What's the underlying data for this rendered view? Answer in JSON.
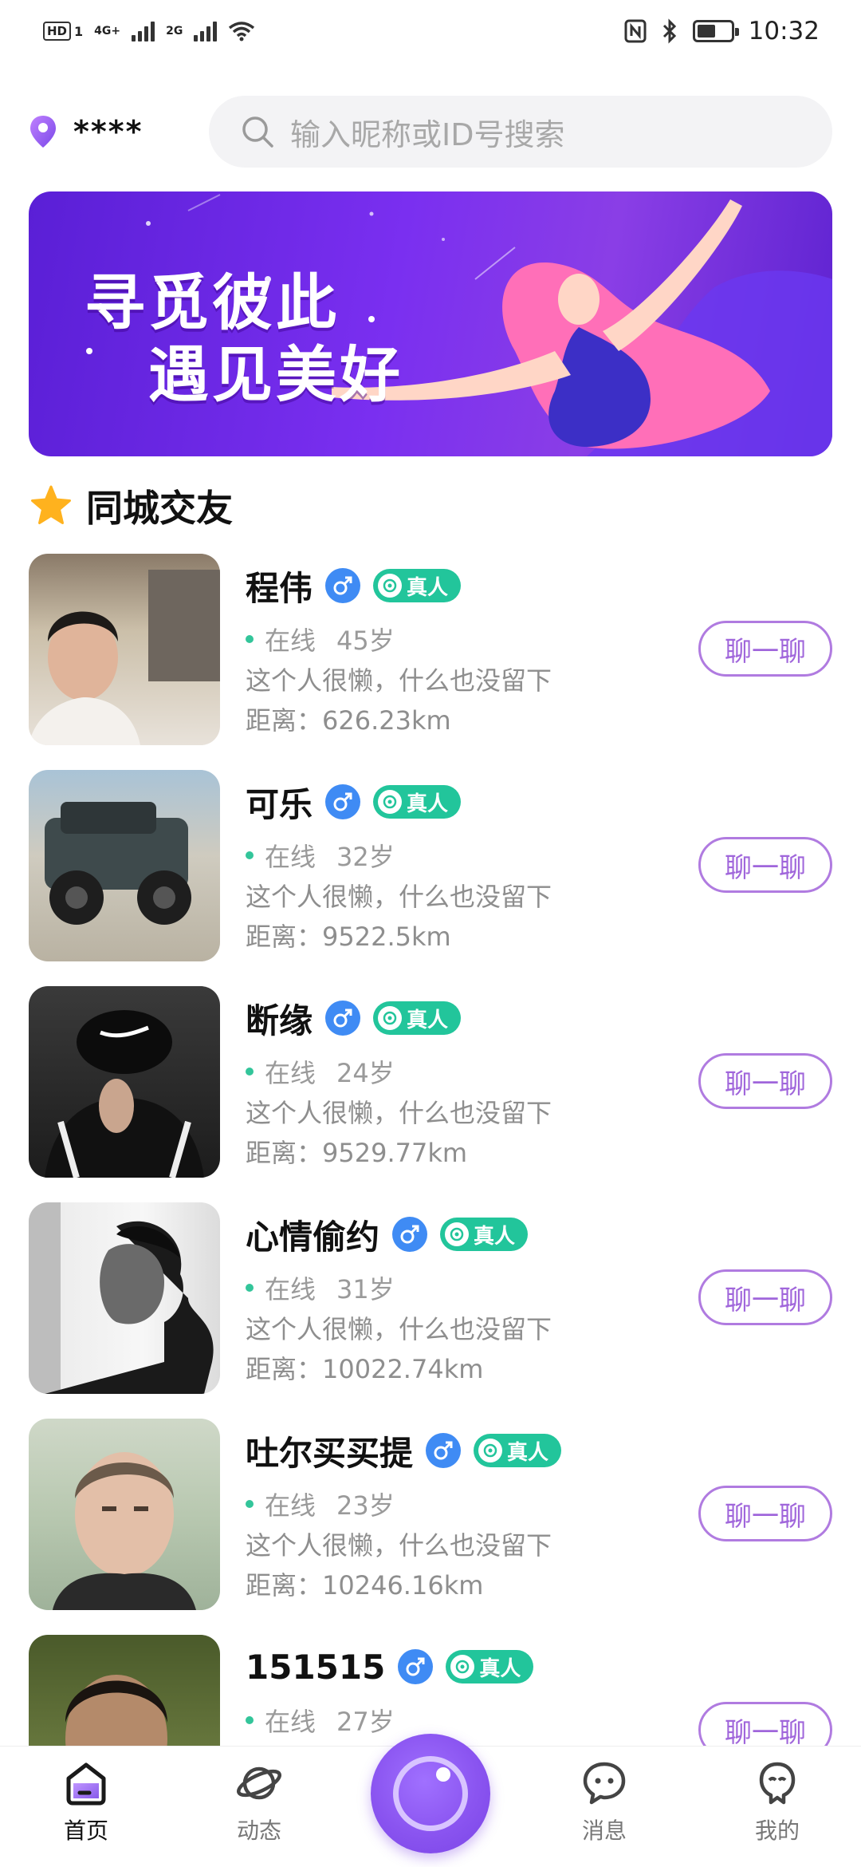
{
  "status_bar": {
    "hd": "HD",
    "sim1": "1",
    "net1": "4G+",
    "net2": "2G",
    "time": "10:32"
  },
  "header": {
    "location": "****",
    "search_placeholder": "输入昵称或ID号搜索"
  },
  "banner": {
    "line1": "寻觅彼此",
    "line2": "遇见美好"
  },
  "section": {
    "title": "同城交友"
  },
  "real_badge": "真人",
  "chat_label": "聊一聊",
  "online_label": "在线",
  "users": [
    {
      "name": "程伟",
      "age": "45岁",
      "bio": "这个人很懒，什么也没留下",
      "distance": "距离：626.23km"
    },
    {
      "name": "可乐",
      "age": "32岁",
      "bio": "这个人很懒，什么也没留下",
      "distance": "距离：9522.5km"
    },
    {
      "name": "断缘",
      "age": "24岁",
      "bio": "这个人很懒，什么也没留下",
      "distance": "距离：9529.77km"
    },
    {
      "name": "心情偷约",
      "age": "31岁",
      "bio": "这个人很懒，什么也没留下",
      "distance": "距离：10022.74km"
    },
    {
      "name": "吐尔买买提",
      "age": "23岁",
      "bio": "这个人很懒，什么也没留下",
      "distance": "距离：10246.16km"
    },
    {
      "name": "151515",
      "age": "27岁",
      "bio": "",
      "distance": ""
    }
  ],
  "tabs": [
    {
      "label": "首页",
      "icon": "home-icon",
      "active": true
    },
    {
      "label": "动态",
      "icon": "planet-icon",
      "active": false
    },
    {
      "label": "消息",
      "icon": "message-icon",
      "active": false
    },
    {
      "label": "我的",
      "icon": "profile-icon",
      "active": false
    }
  ],
  "colors": {
    "accent": "#a066db",
    "real_badge": "#22c59b",
    "gender_male": "#3f8bf4",
    "banner_start": "#5a1fd6",
    "banner_end": "#8a3ee6"
  }
}
